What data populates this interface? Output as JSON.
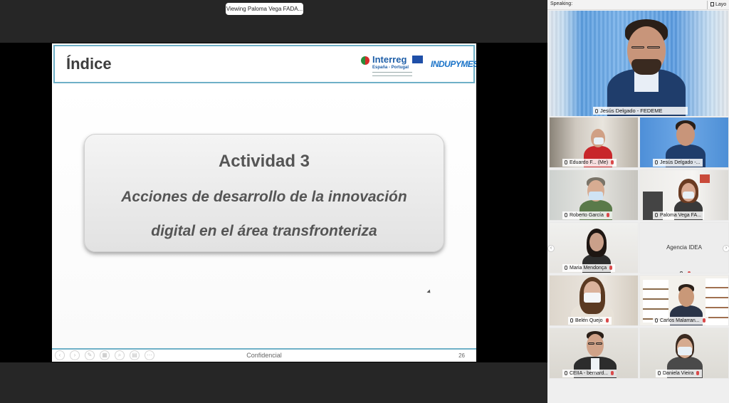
{
  "share": {
    "viewing_label": "Viewing Paloma Vega FADA..."
  },
  "slide": {
    "title": "Índice",
    "logo_interreg_name": "Interreg",
    "logo_interreg_sub": "España - Portugal",
    "logo_indupymes": "INDUPYMES",
    "card_title": "Actividad 3",
    "card_line1": "Acciones de desarrollo de la innovación",
    "card_line2": "digital en el área transfronteriza",
    "footer_text": "Confidencial",
    "page_number": "26"
  },
  "sidebar": {
    "speaking_label": "Speaking:",
    "layout_label": "Layo",
    "main_speaker": "Jesús Delgado - FEDEME",
    "participants": [
      {
        "name": "Eduardo F... (Me)"
      },
      {
        "name": "Jesús Delgado -..."
      },
      {
        "name": "Roberto García"
      },
      {
        "name": "Paloma Vega FA..."
      },
      {
        "name": "Maria Mendonça"
      },
      {
        "name": "Agencia IDEA"
      },
      {
        "name": "Belén Quejo"
      },
      {
        "name": "Carlos Malarran..."
      },
      {
        "name": "CEIIA - bernard..."
      },
      {
        "name": "Daniela Vieira"
      }
    ]
  },
  "colors": {
    "slide_border": "#6fb0c7",
    "mute_red": "#d94a4a"
  }
}
